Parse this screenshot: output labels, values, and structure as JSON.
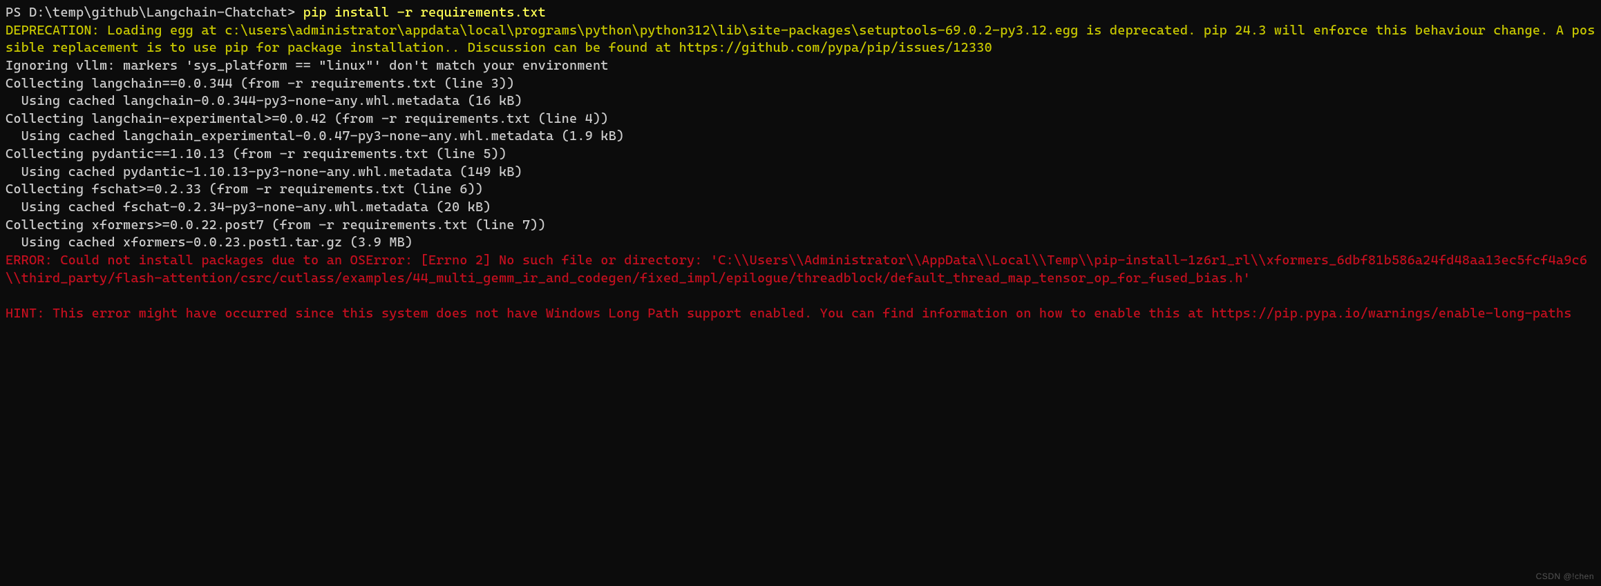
{
  "prompt": {
    "prefix": "PS D:\\temp\\github\\Langchain-Chatchat> ",
    "command": "pip install -r requirements.txt"
  },
  "deprecation": "DEPRECATION: Loading egg at c:\\users\\administrator\\appdata\\local\\programs\\python\\python312\\lib\\site-packages\\setuptools-69.0.2-py3.12.egg is deprecated. pip 24.3 will enforce this behaviour change. A possible replacement is to use pip for package installation.. Discussion can be found at https://github.com/pypa/pip/issues/12330",
  "normal_lines": [
    "Ignoring vllm: markers 'sys_platform == \"linux\"' don't match your environment",
    "Collecting langchain==0.0.344 (from -r requirements.txt (line 3))",
    "  Using cached langchain-0.0.344-py3-none-any.whl.metadata (16 kB)",
    "Collecting langchain-experimental>=0.0.42 (from -r requirements.txt (line 4))",
    "  Using cached langchain_experimental-0.0.47-py3-none-any.whl.metadata (1.9 kB)",
    "Collecting pydantic==1.10.13 (from -r requirements.txt (line 5))",
    "  Using cached pydantic-1.10.13-py3-none-any.whl.metadata (149 kB)",
    "Collecting fschat>=0.2.33 (from -r requirements.txt (line 6))",
    "  Using cached fschat-0.2.34-py3-none-any.whl.metadata (20 kB)",
    "Collecting xformers>=0.0.22.post7 (from -r requirements.txt (line 7))",
    "  Using cached xformers-0.0.23.post1.tar.gz (3.9 MB)"
  ],
  "error_block": "ERROR: Could not install packages due to an OSError: [Errno 2] No such file or directory: 'C:\\\\Users\\\\Administrator\\\\AppData\\\\Local\\\\Temp\\\\pip-install-1z6r1_rl\\\\xformers_6dbf81b586a24fd48aa13ec5fcf4a9c6\\\\third_party/flash-attention/csrc/cutlass/examples/44_multi_gemm_ir_and_codegen/fixed_impl/epilogue/threadblock/default_thread_map_tensor_op_for_fused_bias.h'",
  "hint_block": "HINT: This error might have occurred since this system does not have Windows Long Path support enabled. You can find information on how to enable this at https://pip.pypa.io/warnings/enable-long-paths",
  "watermark": "CSDN @!chen"
}
